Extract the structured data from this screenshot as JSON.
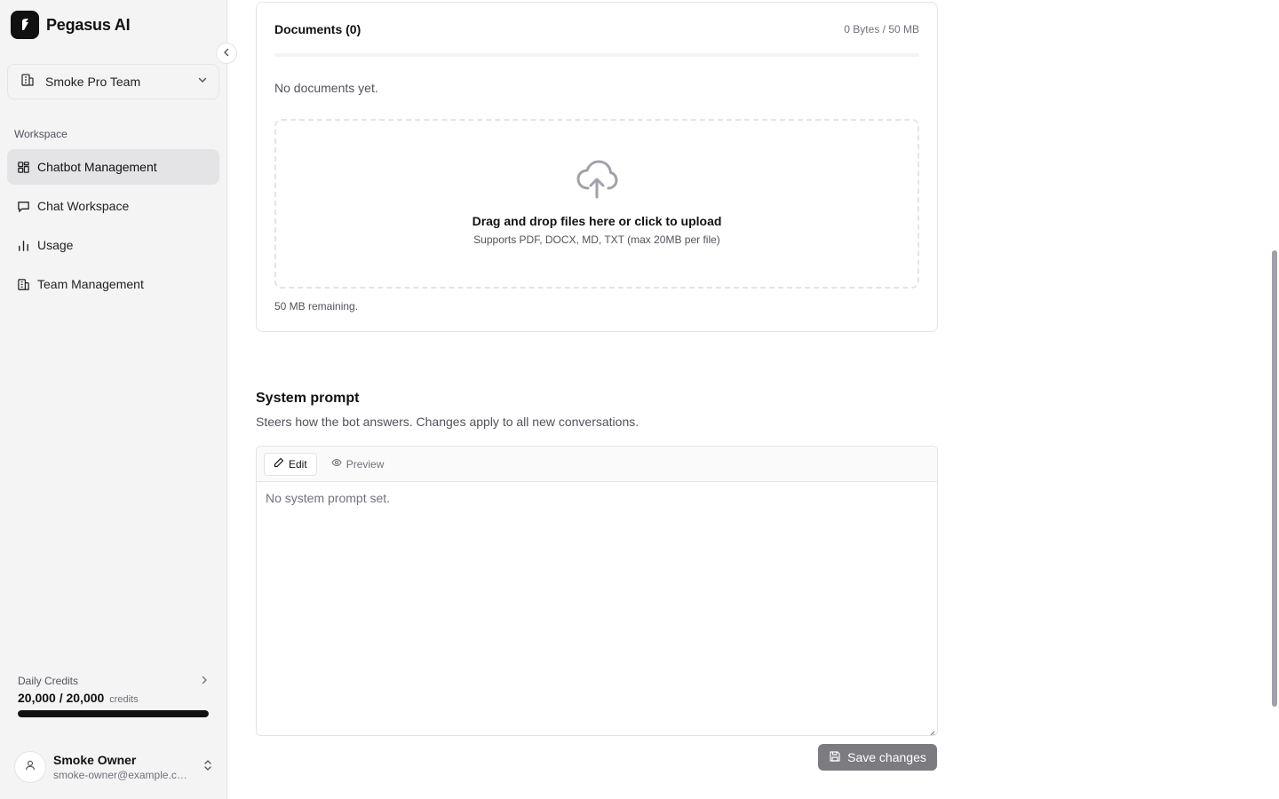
{
  "brand": {
    "name": "Pegasus AI",
    "icon": "pegasus-logo-icon"
  },
  "team": {
    "name": "Smoke Pro Team",
    "icon": "building-icon"
  },
  "sidebar": {
    "section_label": "Workspace",
    "items": [
      {
        "label": "Chatbot Management",
        "icon": "grid-icon",
        "active": true
      },
      {
        "label": "Chat Workspace",
        "icon": "chat-bubble-icon",
        "active": false
      },
      {
        "label": "Usage",
        "icon": "bar-chart-icon",
        "active": false
      },
      {
        "label": "Team Management",
        "icon": "building-icon",
        "active": false
      }
    ]
  },
  "credits": {
    "label": "Daily Credits",
    "value": "20,000 / 20,000",
    "unit": "credits",
    "fraction_used": 1.0
  },
  "user": {
    "name": "Smoke Owner",
    "email": "smoke-owner@example.com"
  },
  "documents": {
    "title": "Documents (0)",
    "size": "0 Bytes / 50 MB",
    "empty_text": "No documents yet.",
    "upload_title": "Drag and drop files here or click to upload",
    "upload_sub": "Supports PDF, DOCX, MD, TXT (max 20MB per file)",
    "remaining": "50 MB remaining."
  },
  "system_prompt": {
    "title": "System prompt",
    "description": "Steers how the bot answers. Changes apply to all new conversations.",
    "tab_edit": "Edit",
    "tab_preview": "Preview",
    "placeholder": "No system prompt set.",
    "save_label": "Save changes"
  },
  "colors": {
    "accent": "#111111",
    "sidebar_bg": "#f4f4f5",
    "save_button": "#7c7c80"
  }
}
